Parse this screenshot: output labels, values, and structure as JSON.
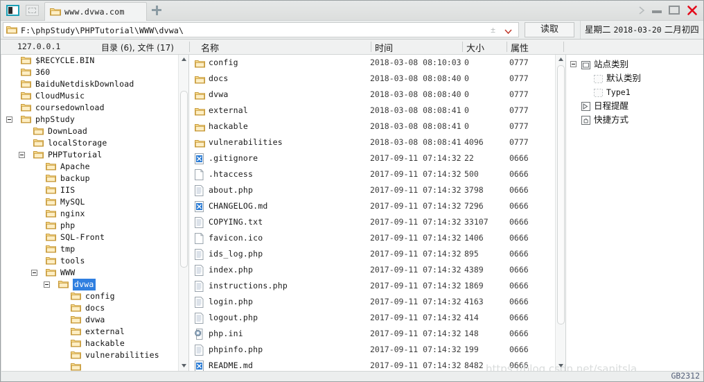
{
  "window": {
    "tab_label": "www.dvwa.com",
    "add_tab_label": "+",
    "controls": {
      "more": "›",
      "minimize": "—",
      "maximize": "□",
      "close": "✕"
    }
  },
  "address_bar": {
    "path": "F:\\phpStudy\\PHPTutorial\\WWW\\dvwa\\",
    "plus_minus": "±",
    "read_button": "读取"
  },
  "date_bar": {
    "weekday": "星期二",
    "date": "2018-03-20",
    "lunar": "二月初四"
  },
  "sub_header": {
    "host": "127.0.0.1",
    "counts": "目录 (6), 文件 (17)",
    "col_name": "名称",
    "col_time": "时间",
    "col_size": "大小",
    "col_attr": "属性"
  },
  "tree": {
    "items": [
      {
        "label": "$RECYCLE.BIN",
        "indent": 0,
        "toggle": false,
        "selected": false
      },
      {
        "label": "360",
        "indent": 0,
        "toggle": false,
        "selected": false
      },
      {
        "label": "BaiduNetdiskDownload",
        "indent": 0,
        "toggle": false,
        "selected": false
      },
      {
        "label": "CloudMusic",
        "indent": 0,
        "toggle": false,
        "selected": false
      },
      {
        "label": "coursedownload",
        "indent": 0,
        "toggle": false,
        "selected": false
      },
      {
        "label": "phpStudy",
        "indent": 0,
        "toggle": true,
        "selected": false
      },
      {
        "label": "DownLoad",
        "indent": 1,
        "toggle": false,
        "selected": false
      },
      {
        "label": "localStorage",
        "indent": 1,
        "toggle": false,
        "selected": false
      },
      {
        "label": "PHPTutorial",
        "indent": 1,
        "toggle": true,
        "selected": false
      },
      {
        "label": "Apache",
        "indent": 2,
        "toggle": false,
        "selected": false
      },
      {
        "label": "backup",
        "indent": 2,
        "toggle": false,
        "selected": false
      },
      {
        "label": "IIS",
        "indent": 2,
        "toggle": false,
        "selected": false
      },
      {
        "label": "MySQL",
        "indent": 2,
        "toggle": false,
        "selected": false
      },
      {
        "label": "nginx",
        "indent": 2,
        "toggle": false,
        "selected": false
      },
      {
        "label": "php",
        "indent": 2,
        "toggle": false,
        "selected": false
      },
      {
        "label": "SQL-Front",
        "indent": 2,
        "toggle": false,
        "selected": false
      },
      {
        "label": "tmp",
        "indent": 2,
        "toggle": false,
        "selected": false
      },
      {
        "label": "tools",
        "indent": 2,
        "toggle": false,
        "selected": false
      },
      {
        "label": "WWW",
        "indent": 2,
        "toggle": true,
        "selected": false
      },
      {
        "label": "dvwa",
        "indent": 3,
        "toggle": true,
        "selected": true
      },
      {
        "label": "config",
        "indent": 4,
        "toggle": false,
        "selected": false
      },
      {
        "label": "docs",
        "indent": 4,
        "toggle": false,
        "selected": false
      },
      {
        "label": "dvwa",
        "indent": 4,
        "toggle": false,
        "selected": false
      },
      {
        "label": "external",
        "indent": 4,
        "toggle": false,
        "selected": false
      },
      {
        "label": "hackable",
        "indent": 4,
        "toggle": false,
        "selected": false
      },
      {
        "label": "vulnerabilities",
        "indent": 4,
        "toggle": false,
        "selected": false
      },
      {
        "label": "",
        "indent": 4,
        "toggle": false,
        "selected": false
      }
    ]
  },
  "file_list": {
    "rows": [
      {
        "name": "config",
        "icon": "folder",
        "time": "2018-03-08 08:10:03",
        "size": "0",
        "attr": "0777"
      },
      {
        "name": "docs",
        "icon": "folder",
        "time": "2018-03-08 08:08:40",
        "size": "0",
        "attr": "0777"
      },
      {
        "name": "dvwa",
        "icon": "folder",
        "time": "2018-03-08 08:08:40",
        "size": "0",
        "attr": "0777"
      },
      {
        "name": "external",
        "icon": "folder",
        "time": "2018-03-08 08:08:41",
        "size": "0",
        "attr": "0777"
      },
      {
        "name": "hackable",
        "icon": "folder",
        "time": "2018-03-08 08:08:41",
        "size": "0",
        "attr": "0777"
      },
      {
        "name": "vulnerabilities",
        "icon": "folder",
        "time": "2018-03-08 08:08:41",
        "size": "4096",
        "attr": "0777"
      },
      {
        "name": ".gitignore",
        "icon": "blue-doc",
        "time": "2017-09-11 07:14:32",
        "size": "22",
        "attr": "0666"
      },
      {
        "name": ".htaccess",
        "icon": "blank-doc",
        "time": "2017-09-11 07:14:32",
        "size": "500",
        "attr": "0666"
      },
      {
        "name": "about.php",
        "icon": "text-doc",
        "time": "2017-09-11 07:14:32",
        "size": "3798",
        "attr": "0666"
      },
      {
        "name": "CHANGELOG.md",
        "icon": "blue-doc",
        "time": "2017-09-11 07:14:32",
        "size": "7296",
        "attr": "0666"
      },
      {
        "name": "COPYING.txt",
        "icon": "text-doc",
        "time": "2017-09-11 07:14:32",
        "size": "33107",
        "attr": "0666"
      },
      {
        "name": "favicon.ico",
        "icon": "blank-doc",
        "time": "2017-09-11 07:14:32",
        "size": "1406",
        "attr": "0666"
      },
      {
        "name": "ids_log.php",
        "icon": "text-doc",
        "time": "2017-09-11 07:14:32",
        "size": "895",
        "attr": "0666"
      },
      {
        "name": "index.php",
        "icon": "text-doc",
        "time": "2017-09-11 07:14:32",
        "size": "4389",
        "attr": "0666"
      },
      {
        "name": "instructions.php",
        "icon": "text-doc",
        "time": "2017-09-11 07:14:32",
        "size": "1869",
        "attr": "0666"
      },
      {
        "name": "login.php",
        "icon": "text-doc",
        "time": "2017-09-11 07:14:32",
        "size": "4163",
        "attr": "0666"
      },
      {
        "name": "logout.php",
        "icon": "text-doc",
        "time": "2017-09-11 07:14:32",
        "size": "414",
        "attr": "0666"
      },
      {
        "name": "php.ini",
        "icon": "gear-doc",
        "time": "2017-09-11 07:14:32",
        "size": "148",
        "attr": "0666"
      },
      {
        "name": "phpinfo.php",
        "icon": "text-doc",
        "time": "2017-09-11 07:14:32",
        "size": "199",
        "attr": "0666"
      },
      {
        "name": "README.md",
        "icon": "blue-doc",
        "time": "2017-09-11 07:14:32",
        "size": "8482",
        "attr": "0666"
      }
    ]
  },
  "right_panel": {
    "items": [
      {
        "label": "站点类别",
        "indent": 0,
        "toggle": true,
        "icon": "window-icon",
        "mono": false
      },
      {
        "label": "默认类别",
        "indent": 1,
        "toggle": false,
        "icon": "dashed-icon",
        "mono": false
      },
      {
        "label": "Type1",
        "indent": 1,
        "toggle": false,
        "icon": "dashed-icon",
        "mono": true
      },
      {
        "label": "日程提醒",
        "indent": 0,
        "toggle": false,
        "icon": "calendar-icon",
        "mono": false
      },
      {
        "label": "快捷方式",
        "indent": 0,
        "toggle": false,
        "icon": "hand-icon",
        "mono": false
      }
    ]
  },
  "status_bar": {
    "encoding": "GB2312",
    "watermark": "https://blog.csdn.net/sanitsla"
  },
  "colors": {
    "accent_blue": "#2f7fe0",
    "close_red": "#e30b1b",
    "folder_yellow": "#f6d27a",
    "chrome_gray": "#e0e2e2"
  }
}
